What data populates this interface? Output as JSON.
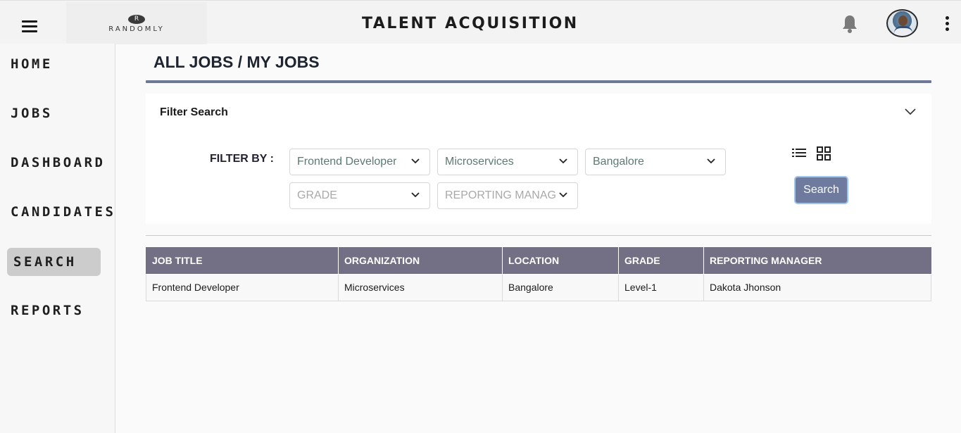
{
  "header": {
    "logo_text": "RANDOMLY",
    "logo_mark": "R",
    "app_title": "TALENT ACQUISITION",
    "icons": [
      "menu-icon",
      "bell-icon",
      "avatar",
      "more-vertical-icon"
    ]
  },
  "sidebar": {
    "items": [
      {
        "label": "HOME",
        "active": false
      },
      {
        "label": "JOBS",
        "active": false
      },
      {
        "label": "DASHBOARD",
        "active": false
      },
      {
        "label": "CANDIDATES",
        "active": false
      },
      {
        "label": "SEARCH",
        "active": true
      },
      {
        "label": "REPORTS",
        "active": false
      }
    ]
  },
  "page": {
    "title": "ALL JOBS / MY JOBS"
  },
  "filter": {
    "heading": "Filter Search",
    "filter_by_label": "FILTER BY :",
    "job_title_value": "Frontend Developer",
    "organization_value": "Microservices",
    "location_value": "Bangalore",
    "grade_placeholder": "GRADE",
    "manager_placeholder": "REPORTING MANAGER",
    "search_label": "Search",
    "view_icons": [
      "list-view-icon",
      "grid-view-icon"
    ]
  },
  "table": {
    "headers": [
      "JOB TITLE",
      "ORGANIZATION",
      "LOCATION",
      "GRADE",
      "REPORTING MANAGER"
    ],
    "rows": [
      [
        "Frontend Developer",
        "Microservices",
        "Bangalore",
        "Level-1",
        "Dakota Jhonson"
      ]
    ]
  },
  "colors": {
    "accent": "#6f7799",
    "table_header": "#737086",
    "search_button": "#6f7a9f"
  }
}
